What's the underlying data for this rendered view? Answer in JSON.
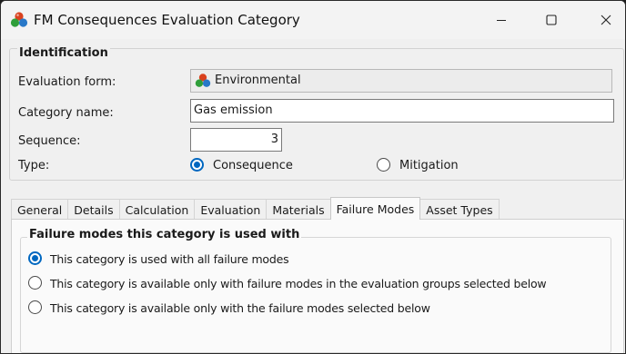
{
  "window": {
    "title": "FM Consequences Evaluation Category",
    "icon": "multi-sphere-app-icon",
    "controls": {
      "minimize": "minimize-icon",
      "maximize": "maximize-icon",
      "close": "close-icon"
    }
  },
  "identification": {
    "title": "Identification",
    "evaluation_form": {
      "label": "Evaluation form:",
      "value": "Environmental",
      "icon": "multi-sphere-icon"
    },
    "category_name": {
      "label": "Category name:",
      "value": "Gas emission"
    },
    "sequence": {
      "label": "Sequence:",
      "value": "3"
    },
    "type": {
      "label": "Type:",
      "options": [
        {
          "label": "Consequence",
          "checked": true
        },
        {
          "label": "Mitigation",
          "checked": false
        }
      ]
    }
  },
  "tabs": [
    {
      "label": "General",
      "active": false
    },
    {
      "label": "Details",
      "active": false
    },
    {
      "label": "Calculation",
      "active": false
    },
    {
      "label": "Evaluation",
      "active": false
    },
    {
      "label": "Materials",
      "active": false
    },
    {
      "label": "Failure Modes",
      "active": true
    },
    {
      "label": "Asset Types",
      "active": false
    }
  ],
  "failure_modes": {
    "title": "Failure modes this category is used with",
    "options": [
      {
        "label": "This category is used with all failure modes",
        "checked": true
      },
      {
        "label": "This category is available only with failure modes in the evaluation groups selected below",
        "checked": false
      },
      {
        "label": "This category is available only with the failure modes selected below",
        "checked": false
      }
    ]
  },
  "colors": {
    "accent": "#0067c0",
    "window_bg": "#f0f0f0",
    "panel_bg": "#fafafa"
  }
}
